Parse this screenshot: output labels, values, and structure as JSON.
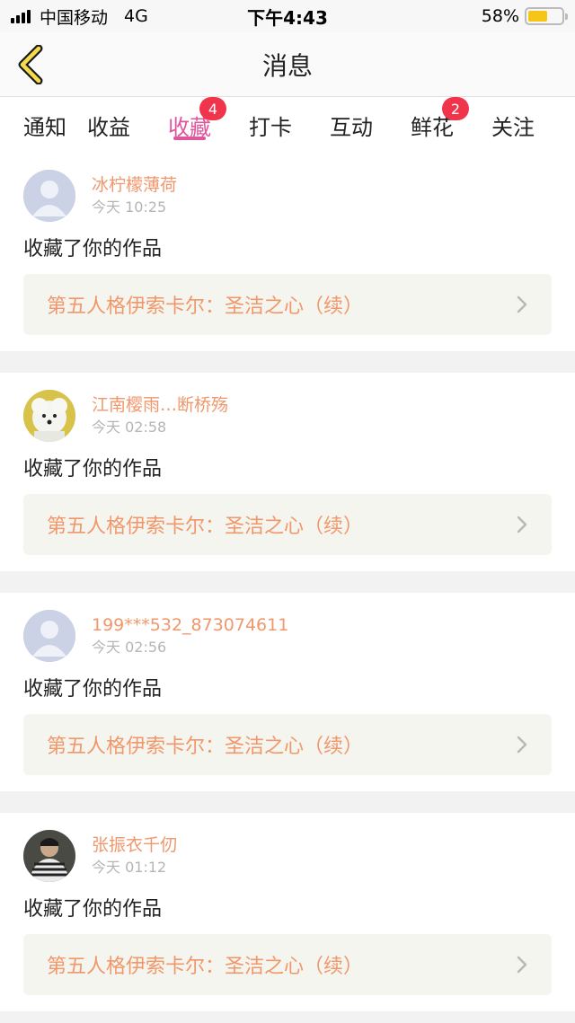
{
  "status_bar": {
    "carrier": "中国移动",
    "network": "4G",
    "time": "下午4:43",
    "battery_percent": "58%",
    "battery_level": 0.58
  },
  "nav": {
    "title": "消息",
    "back_icon": "chevron-left-icon"
  },
  "tabs": [
    {
      "label": "通知",
      "active": false,
      "badge": ""
    },
    {
      "label": "收益",
      "active": false,
      "badge": ""
    },
    {
      "label": "收藏",
      "active": true,
      "badge": "4"
    },
    {
      "label": "打卡",
      "active": false,
      "badge": ""
    },
    {
      "label": "互动",
      "active": false,
      "badge": ""
    },
    {
      "label": "鲜花",
      "active": false,
      "badge": "2"
    },
    {
      "label": "关注",
      "active": false,
      "badge": ""
    }
  ],
  "feed": [
    {
      "username": "冰柠檬薄荷",
      "time": "今天 10:25",
      "action": "收藏了你的作品",
      "work_title": "第五人格伊索卡尔：圣洁之心（续）",
      "avatar": "default-avatar-icon"
    },
    {
      "username": "江南樱雨…断桥殇",
      "time": "今天 02:58",
      "action": "收藏了你的作品",
      "work_title": "第五人格伊索卡尔：圣洁之心（续）",
      "avatar": "dog-avatar"
    },
    {
      "username": "199***532_873074611",
      "time": "今天 02:56",
      "action": "收藏了你的作品",
      "work_title": "第五人格伊索卡尔：圣洁之心（续）",
      "avatar": "default-avatar-icon"
    },
    {
      "username": "张振衣千仞",
      "time": "今天 01:12",
      "action": "收藏了你的作品",
      "work_title": "第五人格伊索卡尔：圣洁之心（续）",
      "avatar": "person-photo-avatar"
    }
  ],
  "colors": {
    "accent": "#e0569d",
    "username": "#f0976b",
    "badge": "#f0344b"
  }
}
